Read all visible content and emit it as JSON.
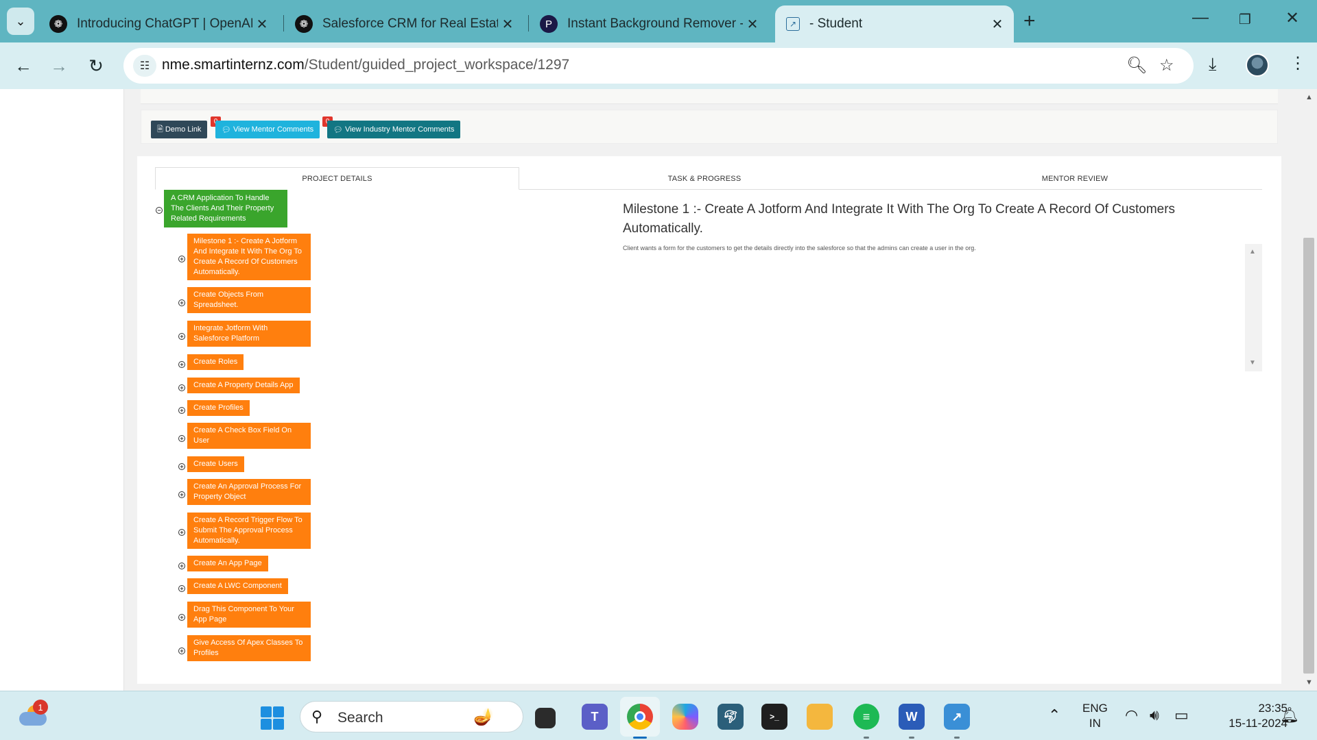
{
  "browser": {
    "tabs": [
      {
        "title": "Introducing ChatGPT | OpenAI",
        "icon": "openai-icon"
      },
      {
        "title": "Salesforce CRM for Real Estate",
        "icon": "openai-icon"
      },
      {
        "title": "Instant Background Remover - f",
        "icon": "pixelcut-icon"
      },
      {
        "title": "- Student",
        "icon": "image-icon"
      }
    ],
    "url_host": "nme.smartinternz.com",
    "url_path": "/Student/guided_project_workspace/1297"
  },
  "buttons": {
    "demo": "Demo Link",
    "mentor": "View Mentor Comments",
    "mentor_count": "0",
    "industry": "View Industry Mentor Comments",
    "industry_count": "0"
  },
  "tabs": {
    "project_details": "PROJECT DETAILS",
    "task_progress": "TASK & PROGRESS",
    "mentor_review": "MENTOR REVIEW"
  },
  "tree": {
    "root": "A CRM Application To Handle The Clients And Their Property Related Requirements",
    "tasks": [
      "Milestone 1 :- Create A Jotform And Integrate It With The Org To Create A Record Of Customers Automatically.",
      "Create Objects From Spreadsheet.",
      "Integrate Jotform With Salesforce Platform",
      "Create Roles",
      "Create A Property Details App",
      "Create Profiles",
      "Create A Check Box Field On User",
      "Create Users",
      "Create An Approval Process For Property Object",
      "Create A Record Trigger Flow To Submit The Approval Process Automatically.",
      "Create An App Page",
      "Create A LWC Component",
      "Drag This Component To Your App Page",
      "Give Access Of Apex Classes To Profiles"
    ]
  },
  "milestone": {
    "title": "Milestone 1 :- Create A Jotform And Integrate It With The Org To Create A Record Of Customers Automatically.",
    "description": "Client wants a form for the customers to get the details directly into the salesforce so that the admins can create a user in the org."
  },
  "taskbar": {
    "search_placeholder": "Search",
    "weather_badge": "1",
    "lang_line1": "ENG",
    "lang_line2": "IN",
    "time": "23:35",
    "date": "15-11-2024"
  },
  "colors": {
    "chrome_tabbar": "#5fb5c1",
    "chrome_toolbar": "#d9eef2",
    "root_node": "#3aa52c",
    "task_node": "#ff7f0e",
    "demo_button": "#2f4858",
    "mentor_button": "#1fb3dd",
    "industry_button": "#127683"
  }
}
